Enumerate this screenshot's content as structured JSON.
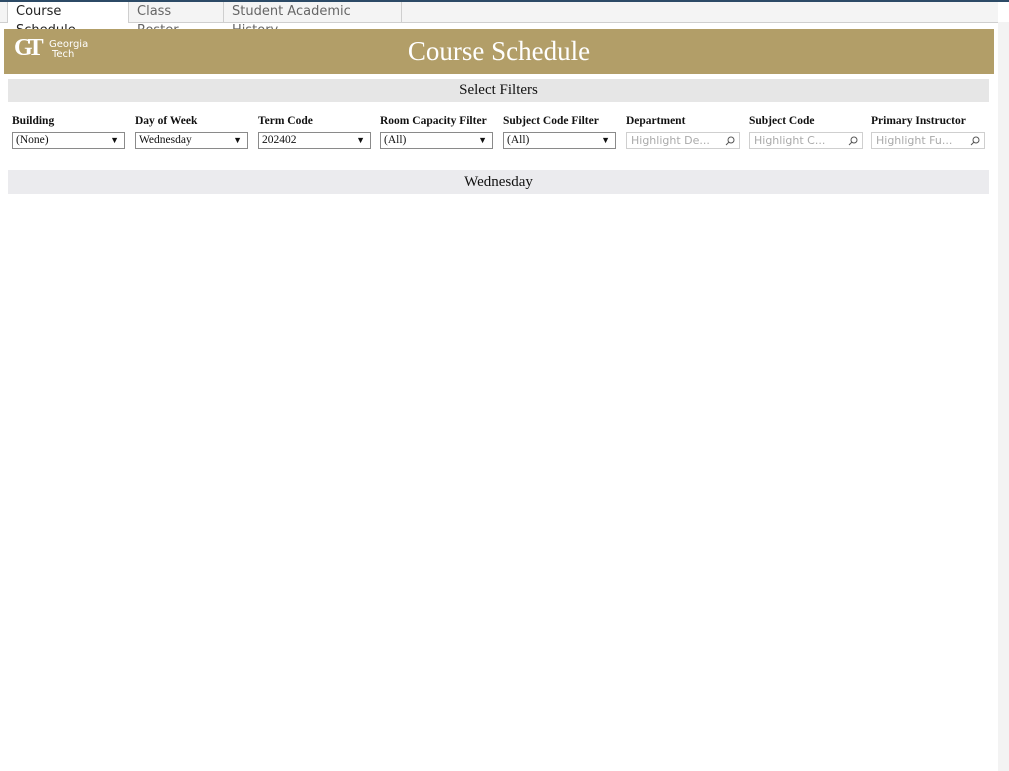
{
  "tabs": [
    {
      "label": "Course Schedule",
      "active": true
    },
    {
      "label": "Class Roster",
      "active": false
    },
    {
      "label": "Student Academic History",
      "active": false
    }
  ],
  "header": {
    "logo_mark": "GT",
    "logo_line1": "Georgia",
    "logo_line2": "Tech",
    "title": "Course Schedule",
    "brand_color": "#b29e68"
  },
  "filters_section": {
    "title": "Select Filters"
  },
  "filters": {
    "dropdowns": [
      {
        "label": "Building",
        "value": "(None)"
      },
      {
        "label": "Day of Week",
        "value": "Wednesday"
      },
      {
        "label": "Term Code",
        "value": "202402"
      },
      {
        "label": "Room Capacity Filter",
        "value": "(All)"
      },
      {
        "label": "Subject Code Filter",
        "value": "(All)"
      }
    ],
    "highlights": [
      {
        "label": "Department",
        "placeholder": "Highlight De..."
      },
      {
        "label": "Subject Code",
        "placeholder": "Highlight C..."
      },
      {
        "label": "Primary Instructor",
        "placeholder": "Highlight Fu..."
      }
    ]
  },
  "day_section": {
    "title": "Wednesday"
  }
}
